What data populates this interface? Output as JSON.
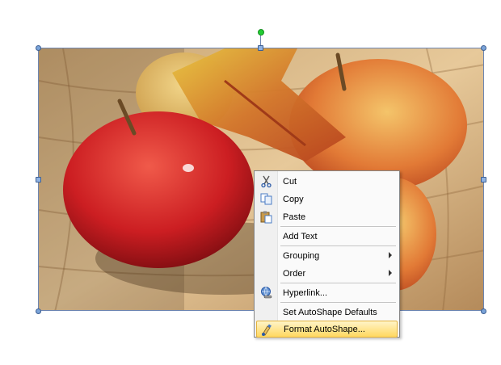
{
  "menu": {
    "items": [
      {
        "label": "Cut",
        "icon": "scissors-icon"
      },
      {
        "label": "Copy",
        "icon": "copy-icon"
      },
      {
        "label": "Paste",
        "icon": "paste-icon"
      },
      {
        "label": "Add Text"
      },
      {
        "label": "Grouping",
        "submenu": true
      },
      {
        "label": "Order",
        "submenu": true
      },
      {
        "label": "Hyperlink...",
        "icon": "hyperlink-icon"
      },
      {
        "label": "Set AutoShape Defaults"
      },
      {
        "label": "Format AutoShape...",
        "icon": "format-autoshape-icon",
        "highlighted": true
      }
    ]
  },
  "colors": {
    "selection_handle": "#7aa3d8",
    "rotation_handle": "#22cc33",
    "highlight": "#ffd860"
  }
}
